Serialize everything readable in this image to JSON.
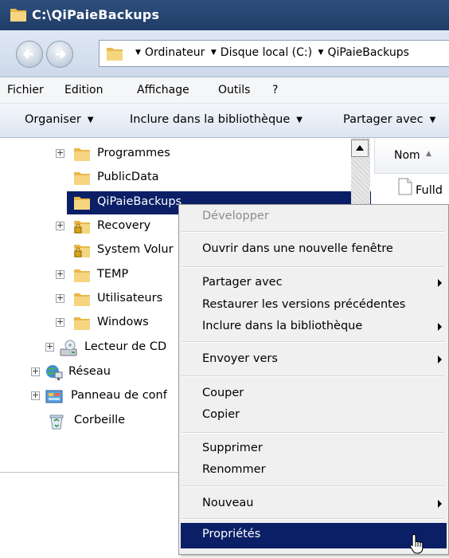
{
  "window": {
    "title": "C:\\QiPaieBackups"
  },
  "address": {
    "crumbs": [
      "Ordinateur",
      "Disque local (C:)",
      "QiPaieBackups"
    ]
  },
  "menubar": {
    "items": [
      "Fichier",
      "Edition",
      "Affichage",
      "Outils",
      "?"
    ]
  },
  "commandbar": {
    "organize": "Organiser",
    "include": "Inclure dans la bibliothèque",
    "share": "Partager avec"
  },
  "tree": {
    "items": [
      {
        "label": "Programmes",
        "icon": "folder-icon",
        "expandable": true
      },
      {
        "label": "PublicData",
        "icon": "folder-icon",
        "expandable": false
      },
      {
        "label": "QiPaieBackups",
        "icon": "folder-icon",
        "expandable": false,
        "selected": true
      },
      {
        "label": "Recovery",
        "icon": "locked-folder-icon",
        "expandable": true
      },
      {
        "label": "System Volur",
        "icon": "locked-folder-icon",
        "expandable": false
      },
      {
        "label": "TEMP",
        "icon": "folder-icon",
        "expandable": true
      },
      {
        "label": "Utilisateurs",
        "icon": "folder-icon",
        "expandable": true
      },
      {
        "label": "Windows",
        "icon": "folder-icon",
        "expandable": true
      },
      {
        "label": "Lecteur de CD",
        "icon": "cd-drive-icon",
        "expandable": true
      },
      {
        "label": "Réseau",
        "icon": "network-icon",
        "expandable": true
      },
      {
        "label": "Panneau de conf",
        "icon": "control-panel-icon",
        "expandable": true
      },
      {
        "label": "Corbeille",
        "icon": "recycle-bin-icon",
        "expandable": false
      }
    ]
  },
  "filelist": {
    "column_name": "Nom",
    "files": [
      {
        "label": "Fulld",
        "icon": "file-icon"
      }
    ]
  },
  "context_menu": {
    "developper": "Développer",
    "ouvrir": "Ouvrir dans une nouvelle fenêtre",
    "partager": "Partager avec",
    "restaurer": "Restaurer les versions précédentes",
    "inclure": "Inclure dans la bibliothèque",
    "envoyer": "Envoyer vers",
    "couper": "Couper",
    "copier": "Copier",
    "supprimer": "Supprimer",
    "renommer": "Renommer",
    "nouveau": "Nouveau",
    "proprietes": "Propriétés"
  },
  "colors": {
    "titlebar": "#1f3c66",
    "selection": "#0b1f66",
    "menu_background": "#f0f0f0"
  }
}
